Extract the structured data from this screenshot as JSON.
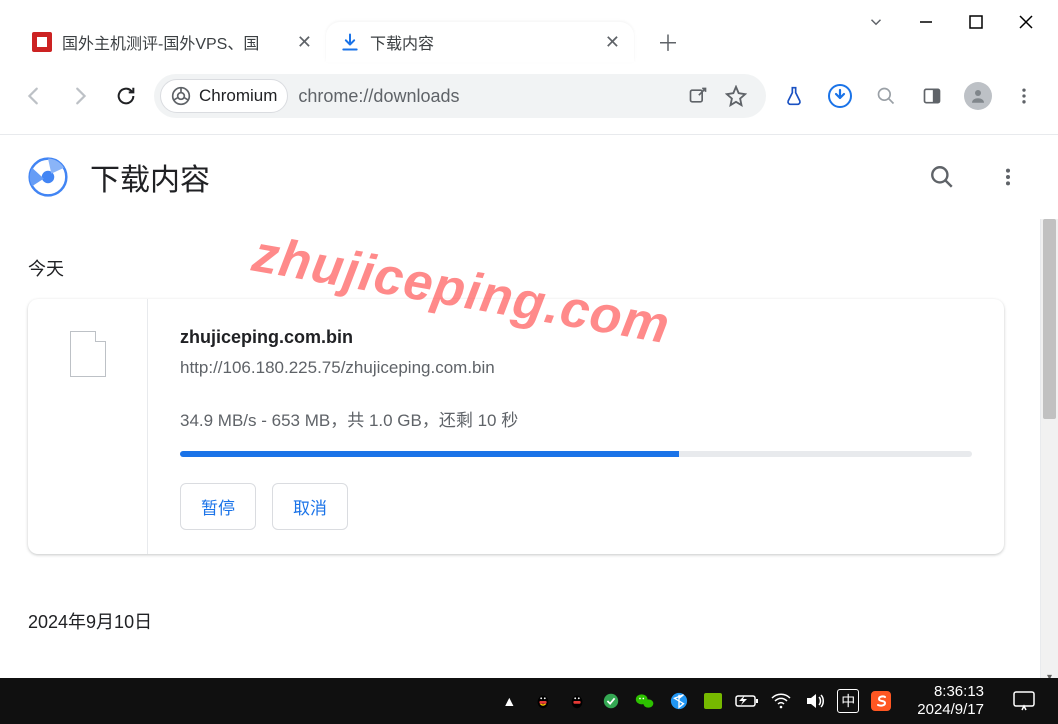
{
  "window": {
    "title_inactive_tab": "国外主机测评-国外VPS、国"
  },
  "tabs": {
    "inactive": {
      "title": "国外主机测评-国外VPS、国"
    },
    "active": {
      "title": "下载内容"
    }
  },
  "toolbar": {
    "secure_label": "Chromium",
    "url": "chrome://downloads"
  },
  "downloads": {
    "page_title": "下载内容",
    "section_today": "今天",
    "section_older": "2024年9月10日",
    "item": {
      "filename": "zhujiceping.com.bin",
      "url": "http://106.180.225.75/zhujiceping.com.bin",
      "status_line": "34.9 MB/s - 653 MB，共 1.0 GB，还剩 10 秒",
      "progress_percent": 63,
      "pause_label": "暂停",
      "cancel_label": "取消"
    }
  },
  "watermark": "zhujiceping.com",
  "taskbar": {
    "ime": "中",
    "time": "8:36:13",
    "date": "2024/9/17"
  }
}
